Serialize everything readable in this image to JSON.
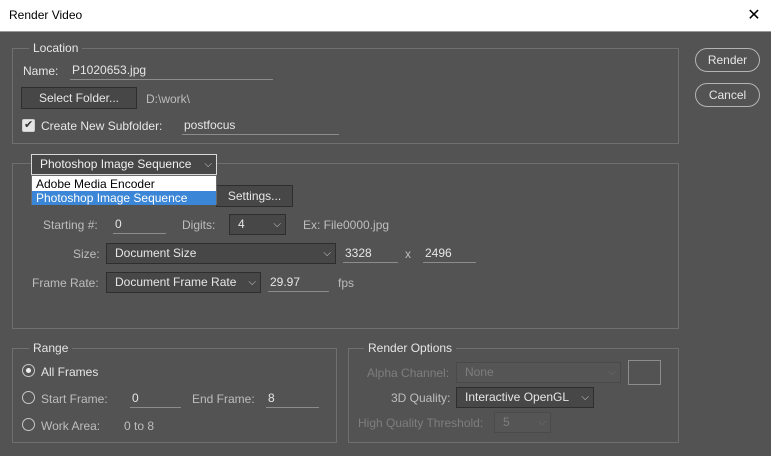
{
  "window": {
    "title": "Render Video",
    "close_symbol": "✕"
  },
  "buttons": {
    "render": "Render",
    "cancel": "Cancel"
  },
  "location": {
    "group_title": "Location",
    "name_label": "Name:",
    "name_value": "P1020653.jpg",
    "select_folder_label": "Select Folder...",
    "folder_path": "D:\\work\\",
    "create_subfolder_label": "Create New Subfolder:",
    "create_subfolder_checked": true,
    "subfolder_value": "postfocus"
  },
  "export": {
    "format_selected": "Photoshop Image Sequence",
    "format_options": [
      "Adobe Media Encoder",
      "Photoshop Image Sequence"
    ],
    "settings_label": "Settings...",
    "starting_label": "Starting #:",
    "starting_value": "0",
    "digits_label": "Digits:",
    "digits_value": "4",
    "example_text": "Ex: File0000.jpg",
    "size_label": "Size:",
    "size_value": "Document Size",
    "width_value": "3328",
    "x_separator": "x",
    "height_value": "2496",
    "frame_rate_label": "Frame Rate:",
    "frame_rate_value": "Document Frame Rate",
    "fps_value": "29.97",
    "fps_unit": "fps"
  },
  "range": {
    "group_title": "Range",
    "all_frames_label": "All Frames",
    "start_frame_label": "Start Frame:",
    "start_frame_value": "0",
    "end_frame_label": "End Frame:",
    "end_frame_value": "8",
    "work_area_label": "Work Area:",
    "work_area_value": "0 to 8",
    "selected": "All Frames"
  },
  "render_options": {
    "group_title": "Render Options",
    "alpha_label": "Alpha Channel:",
    "alpha_value": "None",
    "quality_label": "3D Quality:",
    "quality_value": "Interactive OpenGL",
    "threshold_label": "High Quality Threshold:",
    "threshold_value": "5"
  },
  "icons": {
    "dropdown_arrow": "chevron-down-icon",
    "checkbox_tick": "checkmark-icon",
    "close": "close-icon"
  }
}
